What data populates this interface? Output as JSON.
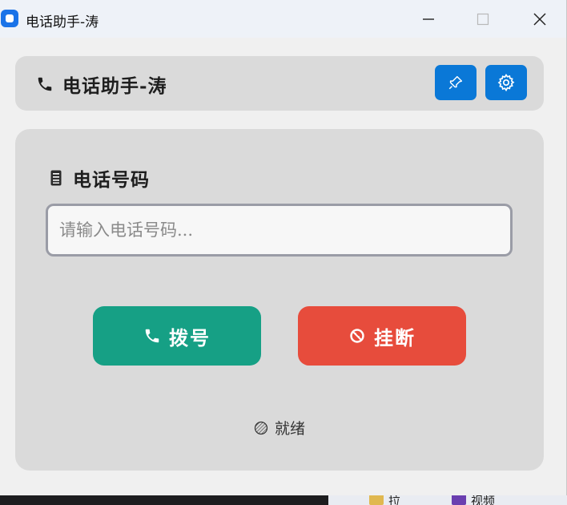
{
  "window": {
    "title": "电话助手-涛"
  },
  "header": {
    "title": "电话助手-涛",
    "pin_button_icon": "pin-icon",
    "settings_button_icon": "gear-icon"
  },
  "form": {
    "label": "电话号码",
    "label_icon": "phone-book-icon",
    "phone_input": {
      "value": "",
      "placeholder": "请输入电话号码..."
    }
  },
  "actions": {
    "dial_label": "拨号",
    "hangup_label": "挂断"
  },
  "status": {
    "text": "就绪"
  },
  "taskbar": {
    "items": [
      {
        "label": "拉",
        "icon": "folder-icon"
      },
      {
        "label": "视频",
        "icon": "video-icon"
      }
    ]
  },
  "colors": {
    "accent": "#0a78d7",
    "dial": "#16a085",
    "hangup": "#e74c3c",
    "card": "#dadada",
    "window_bg": "#f0f0f0"
  }
}
